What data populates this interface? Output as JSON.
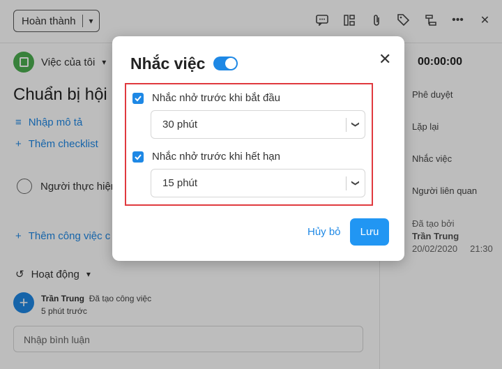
{
  "topbar": {
    "status_label": "Hoàn thành",
    "icons": [
      "comment-icon",
      "subtask-icon",
      "attachment-icon",
      "tag-icon",
      "workflow-icon",
      "more-icon",
      "close-icon"
    ]
  },
  "main": {
    "project_label": "Việc của tôi",
    "task_title": "Chuẩn bị hội n",
    "add_description": "Nhập mô tả",
    "add_checklist": "Thêm checklist",
    "assignee_label": "Người thực hiện",
    "add_subtask": "Thêm công việc c",
    "activity_label": "Hoạt động",
    "activity": {
      "user": "Trần Trung",
      "action": "Đã tạo công việc",
      "time": "5 phút trước",
      "avatar_glyph": "+"
    },
    "comment_placeholder": "Nhập bình luận"
  },
  "side": {
    "timer": "00:00:00",
    "items": [
      "Phê duyệt",
      "Lặp lại",
      "Nhắc việc",
      "Người liên quan"
    ],
    "created_label": "Đã tạo bởi",
    "created_by": "Trần Trung",
    "created_date": "20/02/2020",
    "created_time": "21:30"
  },
  "modal": {
    "title": "Nhắc việc",
    "toggle_on": true,
    "reminders": [
      {
        "label": "Nhắc nhở trước khi bắt đầu",
        "checked": true,
        "value": "30 phút"
      },
      {
        "label": "Nhắc nhở trước khi hết hạn",
        "checked": true,
        "value": "15 phút"
      }
    ],
    "cancel_label": "Hủy bỏ",
    "save_label": "Lưu"
  },
  "colors": {
    "accent": "#1e88e5",
    "highlight": "#e0393e",
    "project": "#4caf50"
  }
}
